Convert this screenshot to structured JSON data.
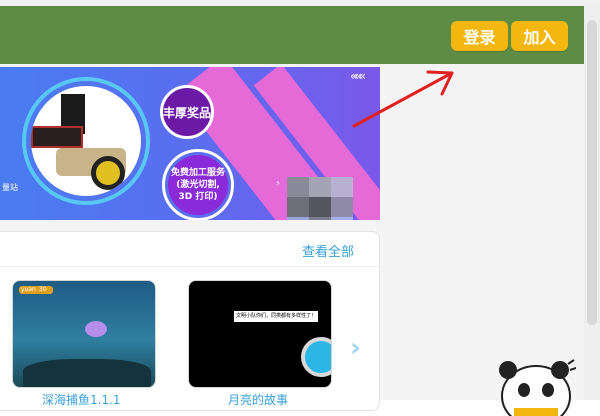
{
  "header": {
    "login_label": "登录",
    "join_label": "加入",
    "bg_color": "#5e8c45",
    "button_color": "#f3b70f"
  },
  "banner": {
    "badge_title": "丰厚奖品",
    "service_line1": "免费加工服务",
    "service_line2": "(激光切割,",
    "service_line3": "3D 打印)",
    "side_text": "量站",
    "arrows_text": "«««",
    "chevron_text": "›"
  },
  "section": {
    "view_all_label": "查看全部"
  },
  "projects": [
    {
      "title": "深海捕鱼1.1.1",
      "tag1": "yuan",
      "tag2": "30"
    },
    {
      "title": "月亮的故事",
      "dialog": "文明小队你们，同类都有多样性了！"
    }
  ],
  "navigation": {
    "next_icon_glyph": "›"
  }
}
